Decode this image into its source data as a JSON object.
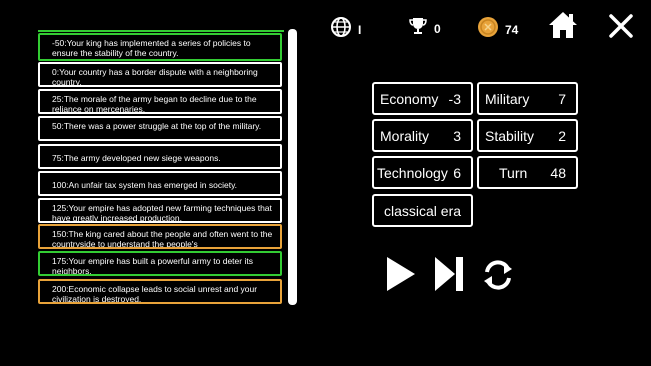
{
  "hud": {
    "globe_value": "I",
    "trophy_value": "0",
    "coin_value": "74"
  },
  "events": [
    {
      "text": "-50:Your king has implemented a series of policies to ensure the stability of the country.",
      "border": "green"
    },
    {
      "text": "0:Your country has a border dispute with a neighboring country.",
      "border": "white"
    },
    {
      "text": "25:The morale of the army began to decline due to the reliance on mercenaries.",
      "border": "white"
    },
    {
      "text": "50:There was a power struggle at the top of the military.",
      "border": "white"
    },
    {
      "text": "75:The army developed new siege weapons.",
      "border": "white"
    },
    {
      "text": "100:An unfair tax system has emerged in society.",
      "border": "white"
    },
    {
      "text": "125:Your empire has adopted new farming techniques that have greatly increased production.",
      "border": "white"
    },
    {
      "text": "150:The king cared about the people and often went to the countryside to understand the people's",
      "border": "orange"
    },
    {
      "text": "175:Your empire has built a powerful army to deter its neighbors.",
      "border": "green"
    },
    {
      "text": "200:Economic collapse leads to social unrest and your civilization is destroyed.",
      "border": "orange"
    }
  ],
  "stats": {
    "economy": {
      "label": "Economy",
      "value": "-3"
    },
    "military": {
      "label": "Military",
      "value": "7"
    },
    "morality": {
      "label": "Morality",
      "value": "3"
    },
    "stability": {
      "label": "Stability",
      "value": "2"
    },
    "technology": {
      "label": "Technology",
      "value": "6"
    },
    "turn": {
      "label": "Turn",
      "value": "48"
    }
  },
  "era": "classical era",
  "colors": {
    "green_border": "#33cc33",
    "orange_border": "#e8a33a",
    "coin": "#e8a33a"
  },
  "icons": [
    "globe-icon",
    "trophy-icon",
    "coin-icon",
    "home-icon",
    "close-icon",
    "play-icon",
    "skip-icon",
    "restart-icon"
  ]
}
